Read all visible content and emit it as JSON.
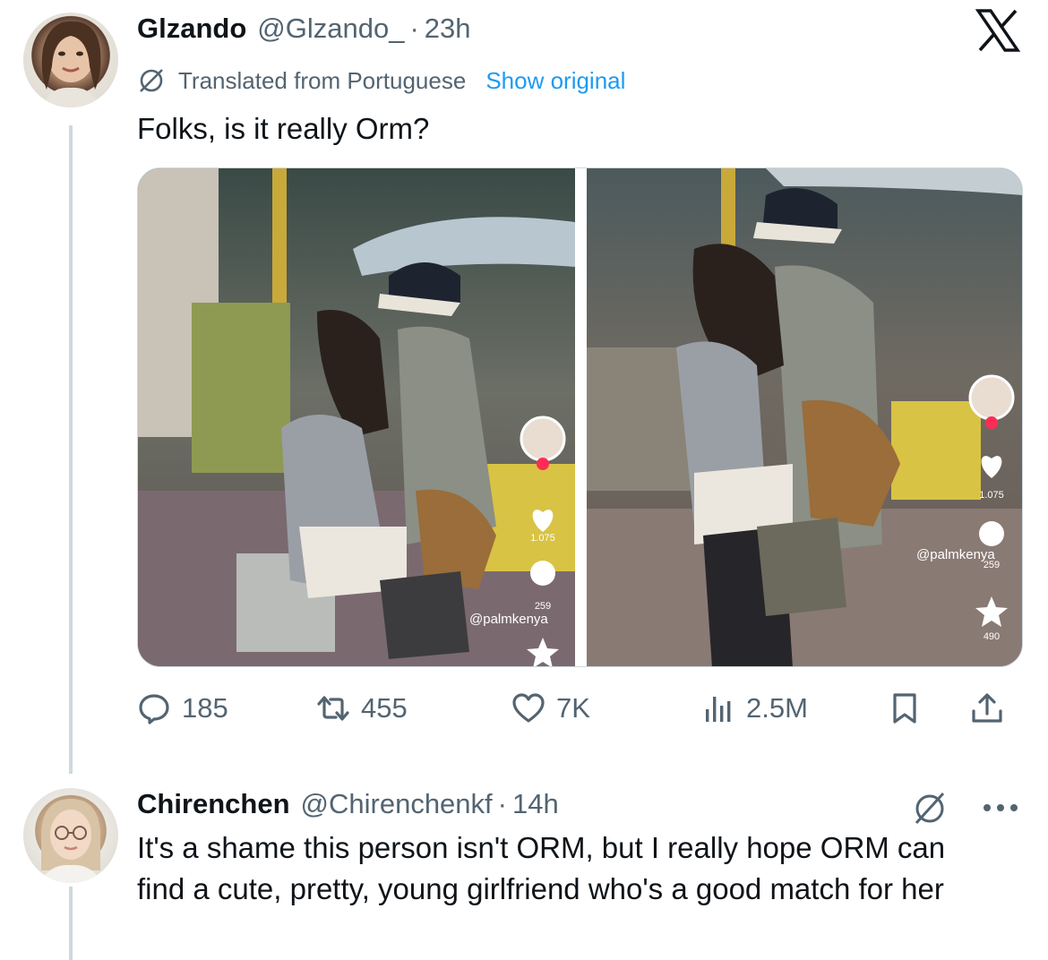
{
  "tweet": {
    "author": {
      "display_name": "Glzando",
      "handle": "@Glzando_",
      "avatar_icon": "profile-photo-woman-curly-hair"
    },
    "separator": "·",
    "time": "23h",
    "brand_icon": "x-logo-icon",
    "translation": {
      "icon": "translate-slash-icon",
      "label": "Translated from Portuguese",
      "link": "Show original"
    },
    "text": "Folks, is it really Orm?",
    "media": {
      "photos": [
        {
          "watermark": "@palmkenya",
          "likes": "1.075",
          "comments": "259"
        },
        {
          "watermark": "@palmkenya",
          "likes": "1.075",
          "comments": "259",
          "stars": "490"
        }
      ]
    },
    "actions": {
      "replies": "185",
      "reposts": "455",
      "likes": "7K",
      "views": "2.5M"
    }
  },
  "reply": {
    "author": {
      "display_name": "Chirenchen",
      "handle": "@Chirenchenkf",
      "avatar_icon": "profile-photo-woman-glasses"
    },
    "separator": "·",
    "time": "14h",
    "text": "It's a shame this person isn't ORM, but I really hope ORM can find a cute, pretty, young girlfriend who's a good match for her"
  },
  "colors": {
    "text_primary": "#0f1419",
    "text_secondary": "#536471",
    "link": "#1d9bf0",
    "thread_line": "#cfd9de"
  }
}
